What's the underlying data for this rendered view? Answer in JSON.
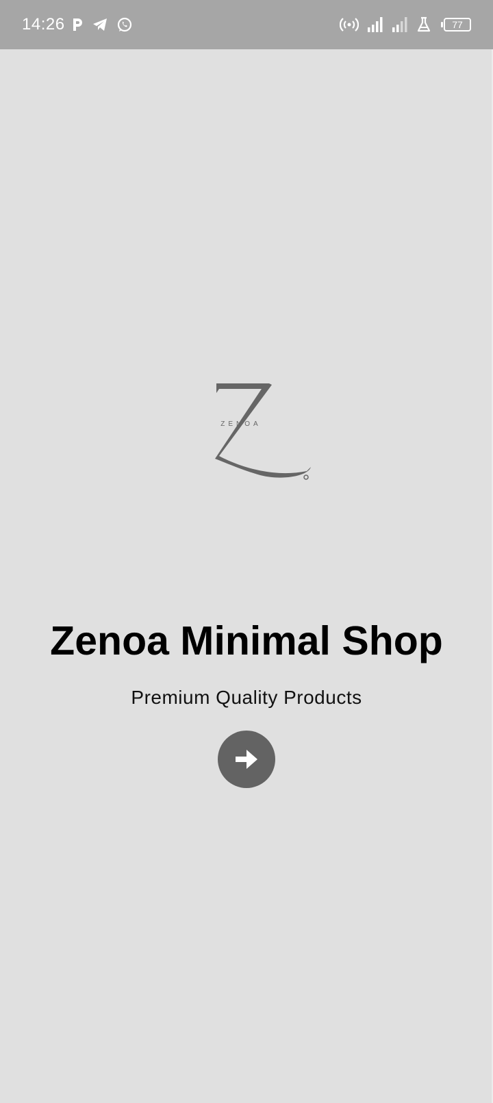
{
  "status_bar": {
    "time": "14:26",
    "left_icons": [
      "p-notification-icon",
      "telegram-icon",
      "whatsapp-icon"
    ],
    "right_icons": [
      "hotspot-icon",
      "signal-icon",
      "signal-icon",
      "lab-flask-icon",
      "battery-icon"
    ],
    "battery_level": "77",
    "text_color": "#ffffff",
    "background": "#a6a6a6"
  },
  "logo": {
    "brand_letter": "Z",
    "wordmark": "ZENOA",
    "color": "#666666"
  },
  "main": {
    "title": "Zenoa Minimal Shop",
    "subtitle": "Premium Quality Products",
    "next_button_icon": "arrow-right-icon",
    "button_color": "#636363",
    "background": "#e0e0e0"
  }
}
